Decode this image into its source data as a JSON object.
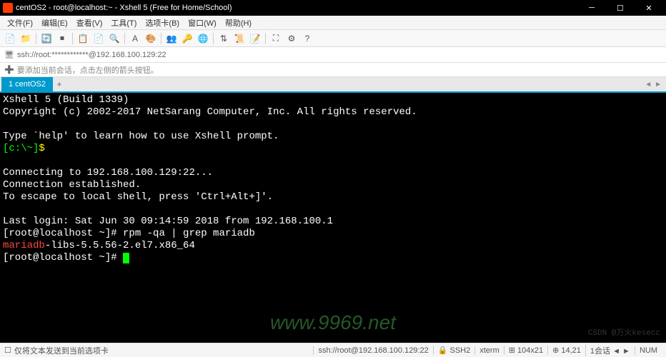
{
  "titlebar": {
    "text": "centOS2 - root@localhost:~ - Xshell 5 (Free for Home/School)"
  },
  "menu": {
    "file": "文件(F)",
    "edit": "编辑(E)",
    "view": "查看(V)",
    "tools": "工具(T)",
    "tabs": "选项卡(B)",
    "window": "窗口(W)",
    "help": "帮助(H)"
  },
  "addressbar": {
    "text": "ssh://root:************@192.168.100.129:22"
  },
  "hintbar": {
    "text": "要添加当前会话，点击左侧的箭头按钮。"
  },
  "tab": {
    "label": "1 centOS2"
  },
  "terminal": {
    "line1": "Xshell 5 (Build 1339)",
    "line2": "Copyright (c) 2002-2017 NetSarang Computer, Inc. All rights reserved.",
    "line3": "",
    "line4": "Type `help' to learn how to use Xshell prompt.",
    "prompt1_a": "[c:\\~]",
    "prompt1_b": "$",
    "line5": "",
    "line6": "Connecting to 192.168.100.129:22...",
    "line7": "Connection established.",
    "line8": "To escape to local shell, press 'Ctrl+Alt+]'.",
    "line9": "",
    "line10": "Last login: Sat Jun 30 09:14:59 2018 from 192.168.100.1",
    "line11_prompt": "[root@localhost ~]# ",
    "line11_cmd": "rpm -qa | grep mariadb",
    "line12_match": "mariadb",
    "line12_rest": "-libs-5.5.56-2.el7.x86_64",
    "line13_prompt": "[root@localhost ~]# "
  },
  "watermark": "www.9969.net",
  "watermark2": "CSDN @万火kesecc",
  "statusbar": {
    "left": "仅将文本发送到当前选项卡",
    "conn": "ssh://root@192.168.100.129:22",
    "ssh": "SSH2",
    "term": "xterm",
    "size": "104x21",
    "pos": "14,21",
    "caps": "NUM"
  }
}
